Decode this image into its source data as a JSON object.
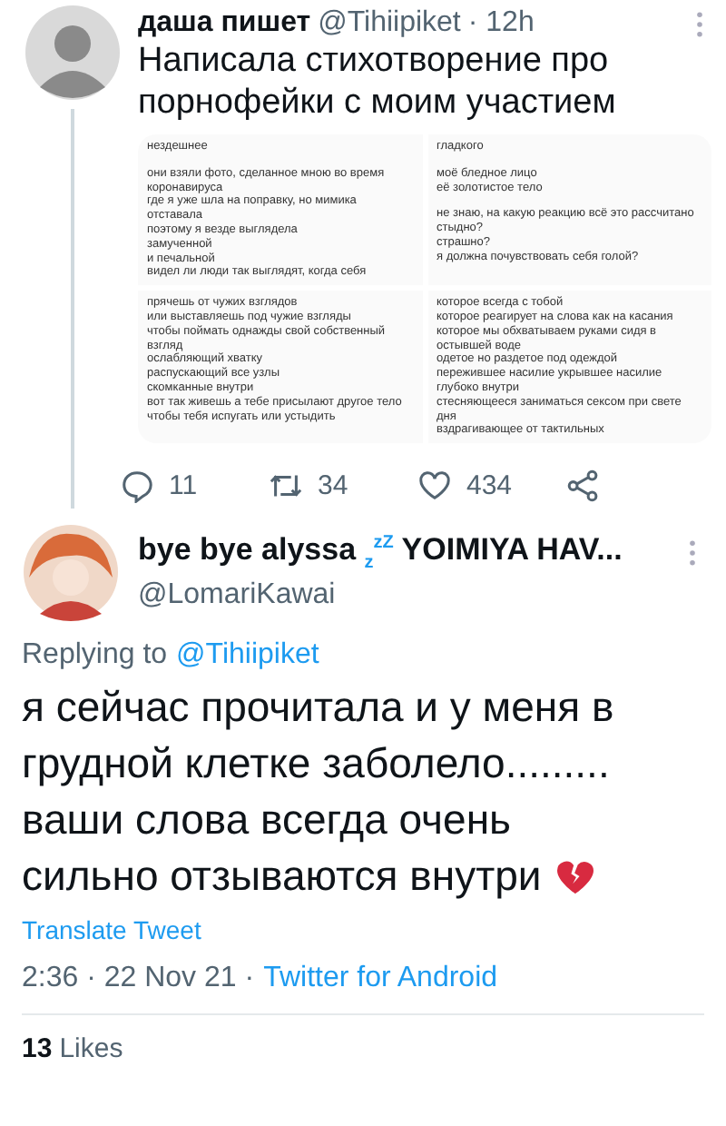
{
  "tweet": {
    "name": "даша пишет",
    "handle": "@Tihiipiket",
    "time": "· 12h",
    "text": "Написала стихотворение про порнофейки с моим участием",
    "images": [
      {
        "stanzas": [
          [
            "нездешнее"
          ],
          [
            "они взяли фото, сделанное мною во время коронавируса",
            "где я уже шла на поправку, но мимика отставала",
            "поэтому я везде выглядела",
            "замученной",
            "и печальной",
            "видел ли люди так выглядят, когда себя"
          ]
        ]
      },
      {
        "stanzas": [
          [
            "гладкого"
          ],
          [
            "моё бледное лицо",
            "её золотистое тело"
          ],
          [
            "не знаю, на какую реакцию всё это рассчитано",
            "стыдно?",
            "страшно?",
            "я должна почувствовать себя голой?"
          ]
        ]
      },
      {
        "stanzas": [
          [
            "прячешь от чужих взглядов",
            "или выставляешь под чужие взгляды",
            "чтобы поймать однажды свой собственный взгляд",
            "ослабляющий хватку",
            "распускающий все узлы",
            "скомканные внутри",
            "вот так живешь а тебе присылают другое тело",
            "чтобы тебя испугать или устыдить"
          ]
        ]
      },
      {
        "stanzas": [
          [
            "которое всегда с тобой",
            "которое реагирует на слова как на касания",
            "которое мы обхватываем руками сидя в остывшей воде",
            "одетое но раздетое под одеждой",
            "пережившее насилие укрывшее насилие глубоко внутри",
            "стесняющееся заниматься сексом при свете дня",
            "вздрагивающее от тактильных"
          ]
        ]
      }
    ],
    "actions": [
      {
        "kind": "reply",
        "count": "11"
      },
      {
        "kind": "retweet",
        "count": "34"
      },
      {
        "kind": "like",
        "count": "434"
      },
      {
        "kind": "share"
      }
    ]
  },
  "reply": {
    "name": "bye bye alyssa $_{z}$$^{z}$$^{Z}$ YOIMIYA HAV...",
    "handle": "@LomariKawai",
    "replying_label": "Replying to",
    "replying_to": "@Tihiipiket",
    "text_lines": [
      "я сейчас прочитала и у меня в",
      "грудной клетке заболело.........",
      "ваши слова всегда очень",
      "сильно отзываются внутри"
    ],
    "translate": "Translate Tweet",
    "timestamp": "2:36 · 22 Nov 21 ·",
    "source": "Twitter for Android",
    "likes_count": "13",
    "likes_label": "Likes"
  }
}
